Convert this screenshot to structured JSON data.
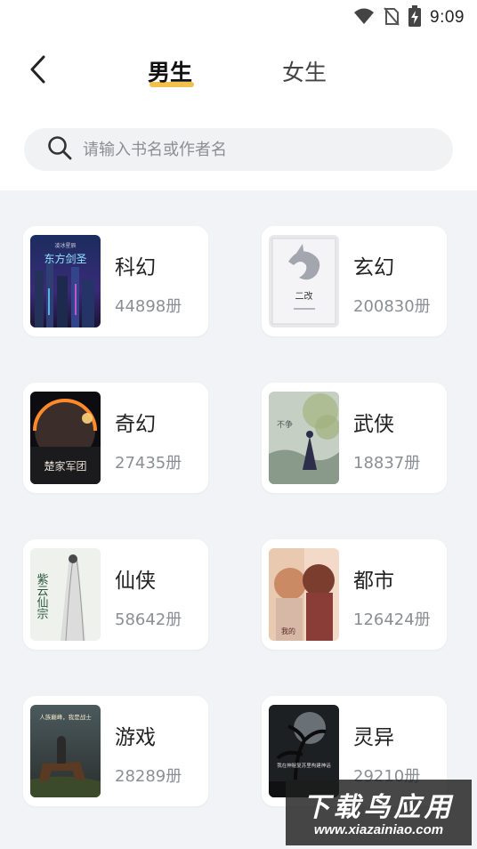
{
  "status_bar": {
    "time": "9:09",
    "icons": [
      "wifi-icon",
      "no-sim-icon",
      "battery-charging-icon"
    ]
  },
  "header": {
    "back_icon": "back-arrow-icon",
    "tabs": [
      {
        "label": "男生",
        "active": true
      },
      {
        "label": "女生",
        "active": false
      }
    ],
    "accent_color": "#f2c14b"
  },
  "search": {
    "placeholder": "请输入书名或作者名",
    "value": "",
    "icon": "search-icon"
  },
  "categories": [
    {
      "name": "科幻",
      "count": "44898册",
      "cover_title": "东方剑圣",
      "cover_top": "凌冰星辰"
    },
    {
      "name": "玄幻",
      "count": "200830册",
      "cover_title": "二改"
    },
    {
      "name": "奇幻",
      "count": "27435册",
      "cover_title": "楚家军团"
    },
    {
      "name": "武侠",
      "count": "18837册",
      "cover_title": "不争"
    },
    {
      "name": "仙侠",
      "count": "58642册",
      "cover_title": "紫云仙宗"
    },
    {
      "name": "都市",
      "count": "126424册",
      "cover_title": "我的"
    },
    {
      "name": "游戏",
      "count": "28289册",
      "cover_title": "人族巅峰，我是战士"
    },
    {
      "name": "灵异",
      "count": "29210册",
      "cover_title": "我在神秘复苏里构建神话"
    }
  ],
  "watermark": {
    "main": "下载鸟应用",
    "url": "www.xiazainiao.com"
  }
}
